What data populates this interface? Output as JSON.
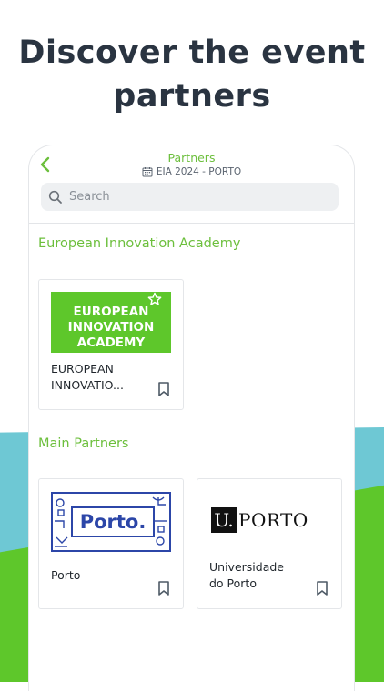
{
  "headline": {
    "line1": "Discover the event",
    "line2": "partners"
  },
  "header": {
    "title": "Partners",
    "subtitle": "EIA 2024 - PORTO"
  },
  "search": {
    "placeholder": "Search"
  },
  "sections": [
    {
      "title": "European Innovation Academy",
      "cards": [
        {
          "name": "EUROPEAN INNOVATIO...",
          "logo_text": [
            "EUROPEAN",
            "INNOVATION",
            "ACADEMY"
          ]
        }
      ]
    },
    {
      "title": "Main Partners",
      "cards": [
        {
          "name": "Porto",
          "logo_text": "Porto."
        },
        {
          "name": "Universidade do Porto",
          "logo_text": {
            "u": "U.",
            "rest": "PORTO"
          }
        }
      ]
    }
  ],
  "colors": {
    "accent_green": "#6cbf3c",
    "brand_green": "#5ec72b",
    "teal": "#6ec8d4",
    "porto_blue": "#2c46a8"
  },
  "icons": [
    "chevron-left-icon",
    "calendar-icon",
    "search-icon",
    "star-icon",
    "bookmark-icon"
  ]
}
